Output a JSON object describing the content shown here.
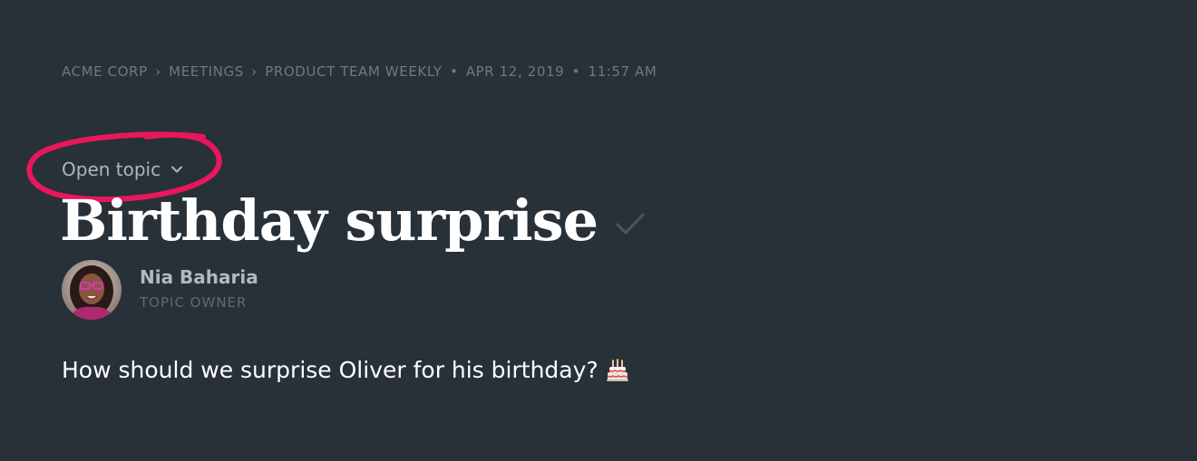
{
  "breadcrumb": {
    "org": "ACME CORP",
    "section": "MEETINGS",
    "meeting": "PRODUCT TEAM WEEKLY",
    "date": "APR 12, 2019",
    "time": "11:57 AM",
    "chevron_sep": "›",
    "bullet_sep": "•"
  },
  "topic": {
    "status_label": "Open topic",
    "status_icon": "chevron-down-icon",
    "title": "Birthday surprise",
    "complete_icon": "check-icon",
    "owner": {
      "name": "Nia Baharia",
      "role": "TOPIC OWNER"
    },
    "description": "How should we surprise Oliver for his birthday?",
    "description_icon": "birthday-cake-icon"
  },
  "annotation": {
    "color": "#e8175d"
  },
  "colors": {
    "background": "#283038",
    "title": "#ffffff",
    "muted": "#6c7a84"
  }
}
